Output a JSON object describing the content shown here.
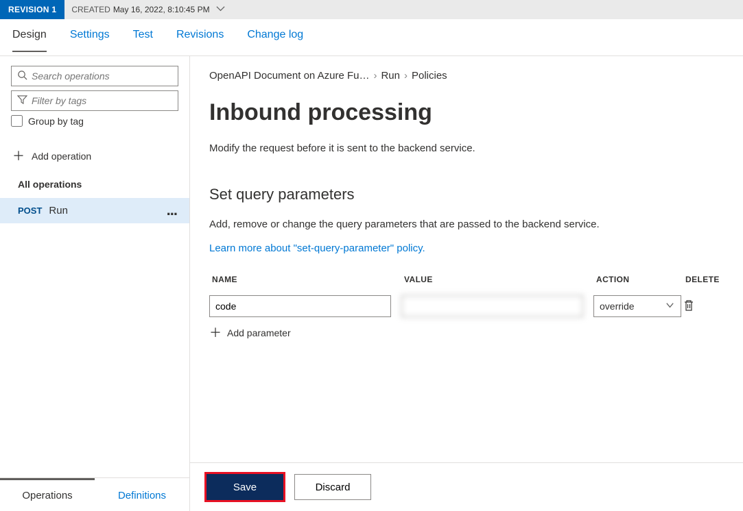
{
  "revision": {
    "badge": "REVISION 1",
    "created_label": "CREATED",
    "created_at": "May 16, 2022, 8:10:45 PM"
  },
  "tabs": {
    "design": "Design",
    "settings": "Settings",
    "test": "Test",
    "revisions": "Revisions",
    "changelog": "Change log"
  },
  "sidebar": {
    "search_placeholder": "Search operations",
    "filter_placeholder": "Filter by tags",
    "group_label": "Group by tag",
    "add_operation": "Add operation",
    "all_ops": "All operations",
    "operations": [
      {
        "method": "POST",
        "name": "Run"
      }
    ],
    "bottom_tabs": {
      "operations": "Operations",
      "definitions": "Definitions"
    }
  },
  "breadcrumb": {
    "api": "OpenAPI Document on Azure Fu…",
    "op": "Run",
    "policies": "Policies"
  },
  "page": {
    "title": "Inbound processing",
    "subtitle": "Modify the request before it is sent to the backend service.",
    "section_title": "Set query parameters",
    "section_desc": "Add, remove or change the query parameters that are passed to the backend service.",
    "learn_link": "Learn more about \"set-query-parameter\" policy."
  },
  "param_table": {
    "headers": {
      "name": "NAME",
      "value": "VALUE",
      "action": "ACTION",
      "delete": "DELETE"
    },
    "rows": [
      {
        "name": "code",
        "value": "",
        "action": "override"
      }
    ],
    "add_param": "Add parameter"
  },
  "footer": {
    "save": "Save",
    "discard": "Discard"
  }
}
